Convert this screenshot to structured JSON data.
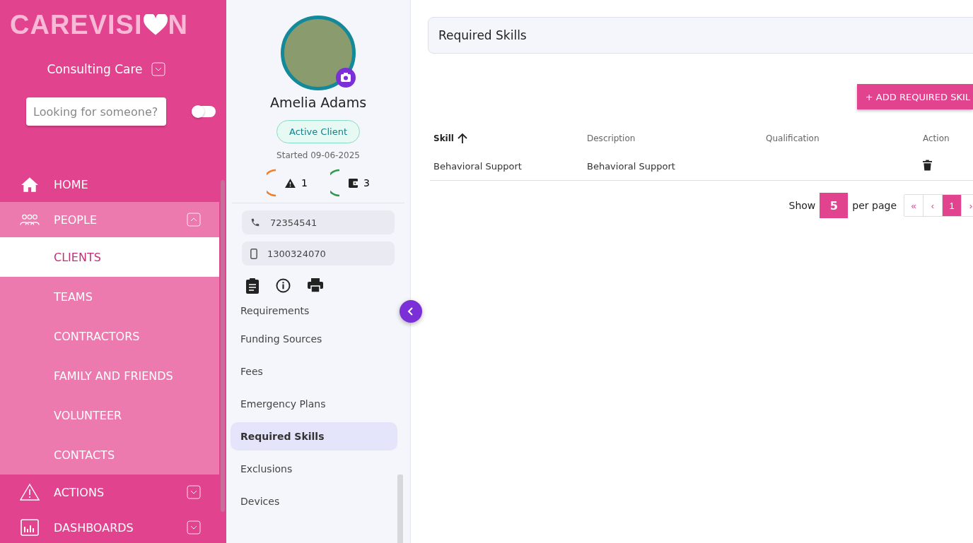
{
  "sidebar": {
    "logo": {
      "before": "CAREVISI",
      "after": "N"
    },
    "organization": "Consulting Care",
    "search": {
      "placeholder": "Looking for someone?"
    },
    "toggle": {
      "on": false
    },
    "nav": [
      {
        "label": "HOME",
        "selected": false
      },
      {
        "label": "PEOPLE",
        "selected": false,
        "expanded": true,
        "children": [
          {
            "label": "CLIENTS",
            "selected": true
          },
          {
            "label": "TEAMS",
            "selected": false
          },
          {
            "label": "CONTRACTORS",
            "selected": false
          },
          {
            "label": "FAMILY AND FRIENDS",
            "selected": false
          },
          {
            "label": "VOLUNTEER",
            "selected": false
          },
          {
            "label": "CONTACTS",
            "selected": false
          }
        ]
      },
      {
        "label": "ACTIONS",
        "selected": false,
        "expanded": false
      },
      {
        "label": "DASHBOARDS",
        "selected": false,
        "expanded": false
      }
    ]
  },
  "profile": {
    "name": "Amelia Adams",
    "status": "Active Client",
    "started": "Started 09-06-2025",
    "counters": [
      {
        "value": "1",
        "color": "#f07f2a"
      },
      {
        "value": "3",
        "color": "#2e9a4c"
      }
    ],
    "contacts": [
      {
        "kind": "phone",
        "value": "72354541"
      },
      {
        "kind": "mobile",
        "value": "1300324070"
      }
    ],
    "menu": [
      {
        "label": "Requirements",
        "selected": false
      },
      {
        "label": "Funding Sources",
        "selected": false
      },
      {
        "label": "Fees",
        "selected": false
      },
      {
        "label": "Emergency Plans",
        "selected": false
      },
      {
        "label": "Required Skills",
        "selected": true
      },
      {
        "label": "Exclusions",
        "selected": false
      },
      {
        "label": "Devices",
        "selected": false
      }
    ]
  },
  "main": {
    "title": "Required Skills",
    "add_button": "+ ADD REQUIRED SKIL",
    "table": {
      "columns": [
        {
          "label": "Skill",
          "sorted": true
        },
        {
          "label": "Description",
          "sorted": false
        },
        {
          "label": "Qualification",
          "sorted": false
        },
        {
          "label": "Action",
          "sorted": false
        }
      ],
      "rows": [
        {
          "skill": "Behavioral Support",
          "description": "Behavioral Support"
        }
      ]
    },
    "pagination": {
      "show_label": "Show",
      "page_size": "5",
      "per_page_label": "per page",
      "buttons": [
        {
          "label": "«",
          "selected": false
        },
        {
          "label": "‹",
          "selected": false
        },
        {
          "label": "1",
          "selected": true
        },
        {
          "label": "›",
          "selected": false
        }
      ]
    }
  }
}
